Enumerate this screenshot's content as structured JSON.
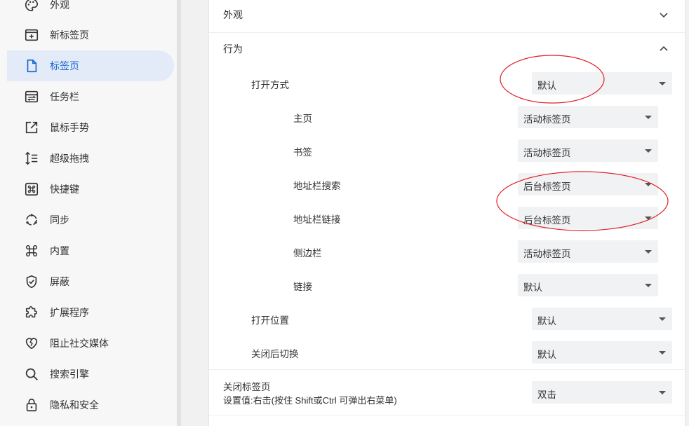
{
  "sidebar": {
    "items": [
      {
        "label": "外观",
        "icon": "palette-icon"
      },
      {
        "label": "新标签页",
        "icon": "new-tab-icon"
      },
      {
        "label": "标签页",
        "icon": "document-icon",
        "active": true
      },
      {
        "label": "任务栏",
        "icon": "taskbar-icon"
      },
      {
        "label": "鼠标手势",
        "icon": "open-external-icon"
      },
      {
        "label": "超级拖拽",
        "icon": "drag-icon"
      },
      {
        "label": "快捷键",
        "icon": "command-key-icon"
      },
      {
        "label": "同步",
        "icon": "sync-icon"
      },
      {
        "label": "内置",
        "icon": "builtin-icon"
      },
      {
        "label": "屏蔽",
        "icon": "shield-icon"
      },
      {
        "label": "扩展程序",
        "icon": "puzzle-icon"
      },
      {
        "label": "阻止社交媒体",
        "icon": "broken-heart-icon"
      },
      {
        "label": "搜索引擎",
        "icon": "search-icon"
      },
      {
        "label": "隐私和安全",
        "icon": "lock-icon"
      }
    ]
  },
  "main": {
    "appearance_section": {
      "title": "外观"
    },
    "behavior_section": {
      "title": "行为"
    },
    "open_method": {
      "label": "打开方式",
      "value": "默认"
    },
    "sub_settings": [
      {
        "label": "主页",
        "value": "活动标签页"
      },
      {
        "label": "书签",
        "value": "活动标签页"
      },
      {
        "label": "地址栏搜索",
        "value": "后台标签页"
      },
      {
        "label": "地址栏链接",
        "value": "后台标签页"
      },
      {
        "label": "侧边栏",
        "value": "活动标签页"
      },
      {
        "label": "链接",
        "value": "默认"
      }
    ],
    "open_position": {
      "label": "打开位置",
      "value": "默认"
    },
    "switch_after_close": {
      "label": "关闭后切换",
      "value": "默认"
    },
    "close_tab": {
      "label": "关闭标签页",
      "hint": "设置值:右击(按住 Shift或Ctrl 可弹出右菜单)",
      "value": "双击"
    }
  },
  "colors": {
    "accent": "#1967d2",
    "active_bg": "#e3ebf8",
    "annotation": "#e0202a"
  }
}
